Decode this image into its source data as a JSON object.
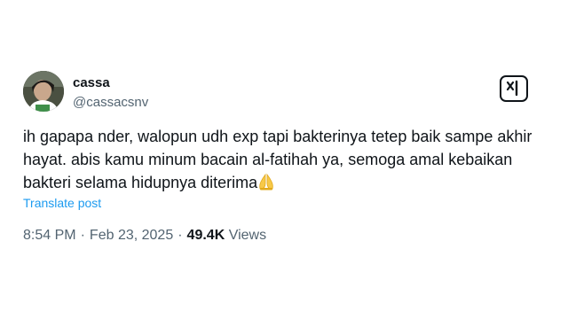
{
  "user": {
    "display_name": "cassa",
    "handle": "@cassacsnv"
  },
  "tweet": {
    "lines": [
      "ih gapapa nder, walopun udh exp tapi bakterinya tetep baik sampe akhir",
      "hayat. abis kamu minum bacain al-fatihah ya, semoga amal kebaikan",
      "bakteri selama hidupnya diterima"
    ],
    "emoji": "folded-hands-emoji",
    "translate_label": "Translate post"
  },
  "meta": {
    "time": "8:54 PM",
    "separator": "·",
    "date": "Feb 23, 2025",
    "views_count": "49.4K",
    "views_label": "Views"
  },
  "colors": {
    "text": "#0f1419",
    "secondary": "#536471",
    "link": "#1d9bf0",
    "background": "#ffffff"
  },
  "icons": {
    "logo": "x-logo-icon"
  }
}
